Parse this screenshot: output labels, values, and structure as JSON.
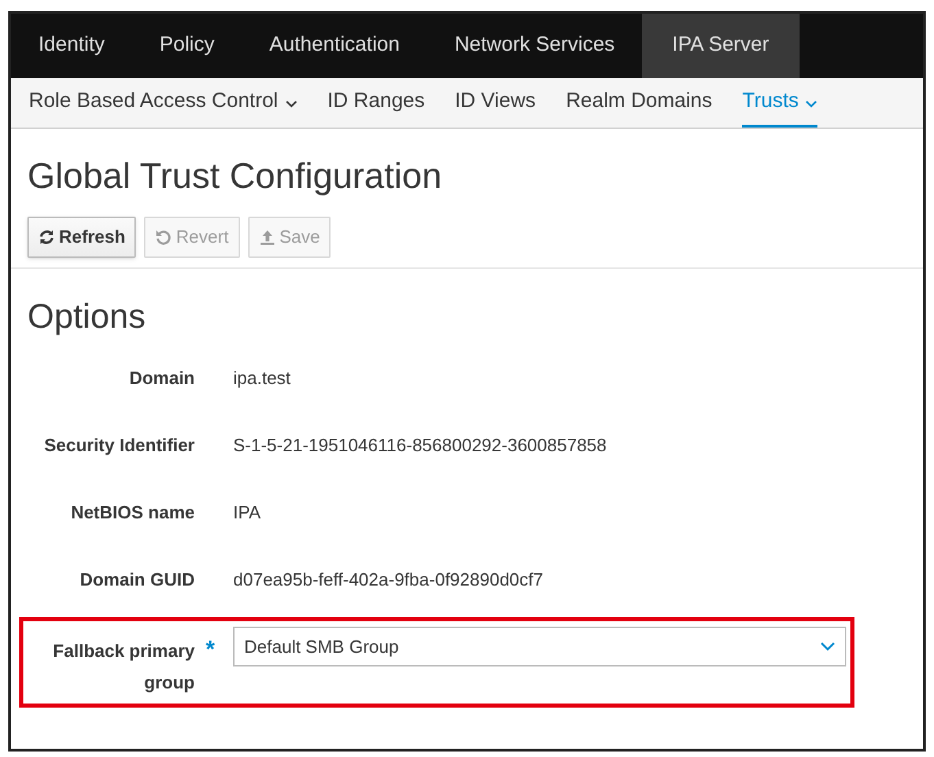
{
  "top_nav": [
    {
      "label": "Identity",
      "selected": false
    },
    {
      "label": "Policy",
      "selected": false
    },
    {
      "label": "Authentication",
      "selected": false
    },
    {
      "label": "Network Services",
      "selected": false
    },
    {
      "label": "IPA Server",
      "selected": true
    }
  ],
  "sub_nav": [
    {
      "label": "Role Based Access Control",
      "selected": false,
      "has_menu": true
    },
    {
      "label": "ID Ranges",
      "selected": false,
      "has_menu": false
    },
    {
      "label": "ID Views",
      "selected": false,
      "has_menu": false
    },
    {
      "label": "Realm Domains",
      "selected": false,
      "has_menu": false
    },
    {
      "label": "Trusts",
      "selected": true,
      "has_menu": true
    }
  ],
  "page_title": "Global Trust Configuration",
  "toolbar": [
    {
      "label": "Refresh",
      "kind": "refresh",
      "disabled": false
    },
    {
      "label": "Revert",
      "kind": "undo",
      "disabled": true
    },
    {
      "label": "Save",
      "kind": "upload",
      "disabled": true
    }
  ],
  "section_title": "Options",
  "fields": [
    {
      "kind": "text",
      "label": "Domain",
      "value": "ipa.test"
    },
    {
      "kind": "text",
      "label": "Security Identifier",
      "value": "S-1-5-21-1951046116-856800292-3600857858"
    },
    {
      "kind": "text",
      "label": "NetBIOS name",
      "value": "IPA"
    },
    {
      "kind": "text",
      "label": "Domain GUID",
      "value": "d07ea95b-feff-402a-9fba-0f92890d0cf7"
    },
    {
      "kind": "select",
      "label": "Fallback primary group",
      "value": "Default SMB Group",
      "required_mark": "*",
      "highlighted": true
    }
  ]
}
